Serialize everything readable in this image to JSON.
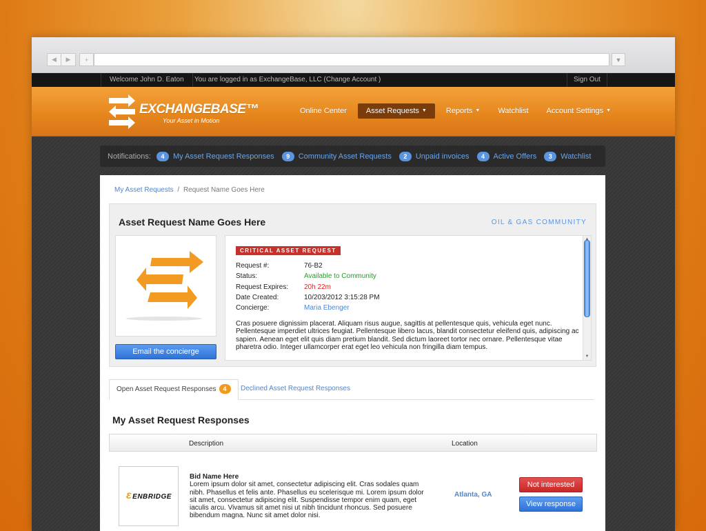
{
  "browser": {
    "back": "◀",
    "forward": "▶",
    "new_tab": "+",
    "dropdown": "▼"
  },
  "topbar": {
    "welcome": "Welcome John D. Eaton",
    "logged_in": "You are logged in as ExchangeBase, LLC  (Change Account )",
    "sign_out": "Sign Out"
  },
  "brand": {
    "name": "EXCHANGEBASE™",
    "tagline": "Your Asset in Motion"
  },
  "nav": {
    "items": [
      {
        "label": "Online Center"
      },
      {
        "label": "Asset Requests",
        "caret": "▼"
      },
      {
        "label": "Reports",
        "caret": "▼"
      },
      {
        "label": "Watchlist"
      },
      {
        "label": "Account Settings",
        "caret": "▼"
      }
    ]
  },
  "notifications": {
    "label": "Notifications:",
    "items": [
      {
        "count": "4",
        "label": "My Asset Request Responses"
      },
      {
        "count": "9",
        "label": "Community Asset Requests"
      },
      {
        "count": "2",
        "label": "Unpaid invoices"
      },
      {
        "count": "4",
        "label": "Active Offers"
      },
      {
        "count": "3",
        "label": "Watchlist"
      }
    ]
  },
  "breadcrumb": {
    "parent": "My Asset Requests",
    "separator": "/",
    "current": "Request Name Goes Here"
  },
  "request": {
    "title": "Asset Request Name Goes Here",
    "community": "OIL & GAS COMMUNITY",
    "badge": "CRITICAL ASSET REQUEST",
    "email_button": "Email the concierge",
    "fields": [
      {
        "key": "Request #:",
        "value": "76-B2"
      },
      {
        "key": "Status:",
        "value": "Available to Community"
      },
      {
        "key": "Request Expires:",
        "value": "20h 22m"
      },
      {
        "key": "Date Created:",
        "value": "10/203/2012 3:15:28 PM"
      },
      {
        "key": "Concierge:",
        "value": "Maria Ebenger"
      }
    ],
    "description": "Cras posuere dignissim placerat. Aliquam risus augue, sagittis at pellentesque quis, vehicula eget nunc. Pellentesque imperdiet ultrices feugiat. Pellentesque libero lacus, blandit consectetur eleifend quis, adipiscing ac sapien. Aenean eget elit quis diam pretium blandit. Sed dictum laoreet tortor nec ornare. Pellentesque vitae pharetra odio. Integer ullamcorper erat eget leo vehicula non fringilla diam tempus."
  },
  "tabs": {
    "open": {
      "label": "Open Asset Request Responses",
      "count": "4"
    },
    "declined": {
      "label": "Declined Asset Request Responses"
    }
  },
  "responses": {
    "title": "My Asset Request Responses",
    "columns": {
      "description": "Description",
      "location": "Location"
    },
    "rows": [
      {
        "logo_text": "ENBRIDGE",
        "name": "Bid Name Here",
        "text": "Lorem ipsum dolor sit amet, consectetur adipiscing elit. Cras sodales quam nibh. Phasellus et felis ante. Phasellus eu scelerisque mi. Lorem ipsum dolor sit amet, consectetur adipiscing elit. Suspendisse tempor enim quam, eget iaculis arcu. Vivamus sit amet nisi ut nibh tincidunt rhoncus. Sed posuere bibendum magna. Nunc sit amet dolor nisi.",
        "location": "Atlanta, GA",
        "decline_label": "Not interested",
        "view_label": "View response"
      }
    ]
  },
  "colors": {
    "accent_orange": "#e5851c",
    "link_blue": "#4a86d4",
    "critical_red": "#c8302a",
    "status_green": "#2a9a2a"
  }
}
